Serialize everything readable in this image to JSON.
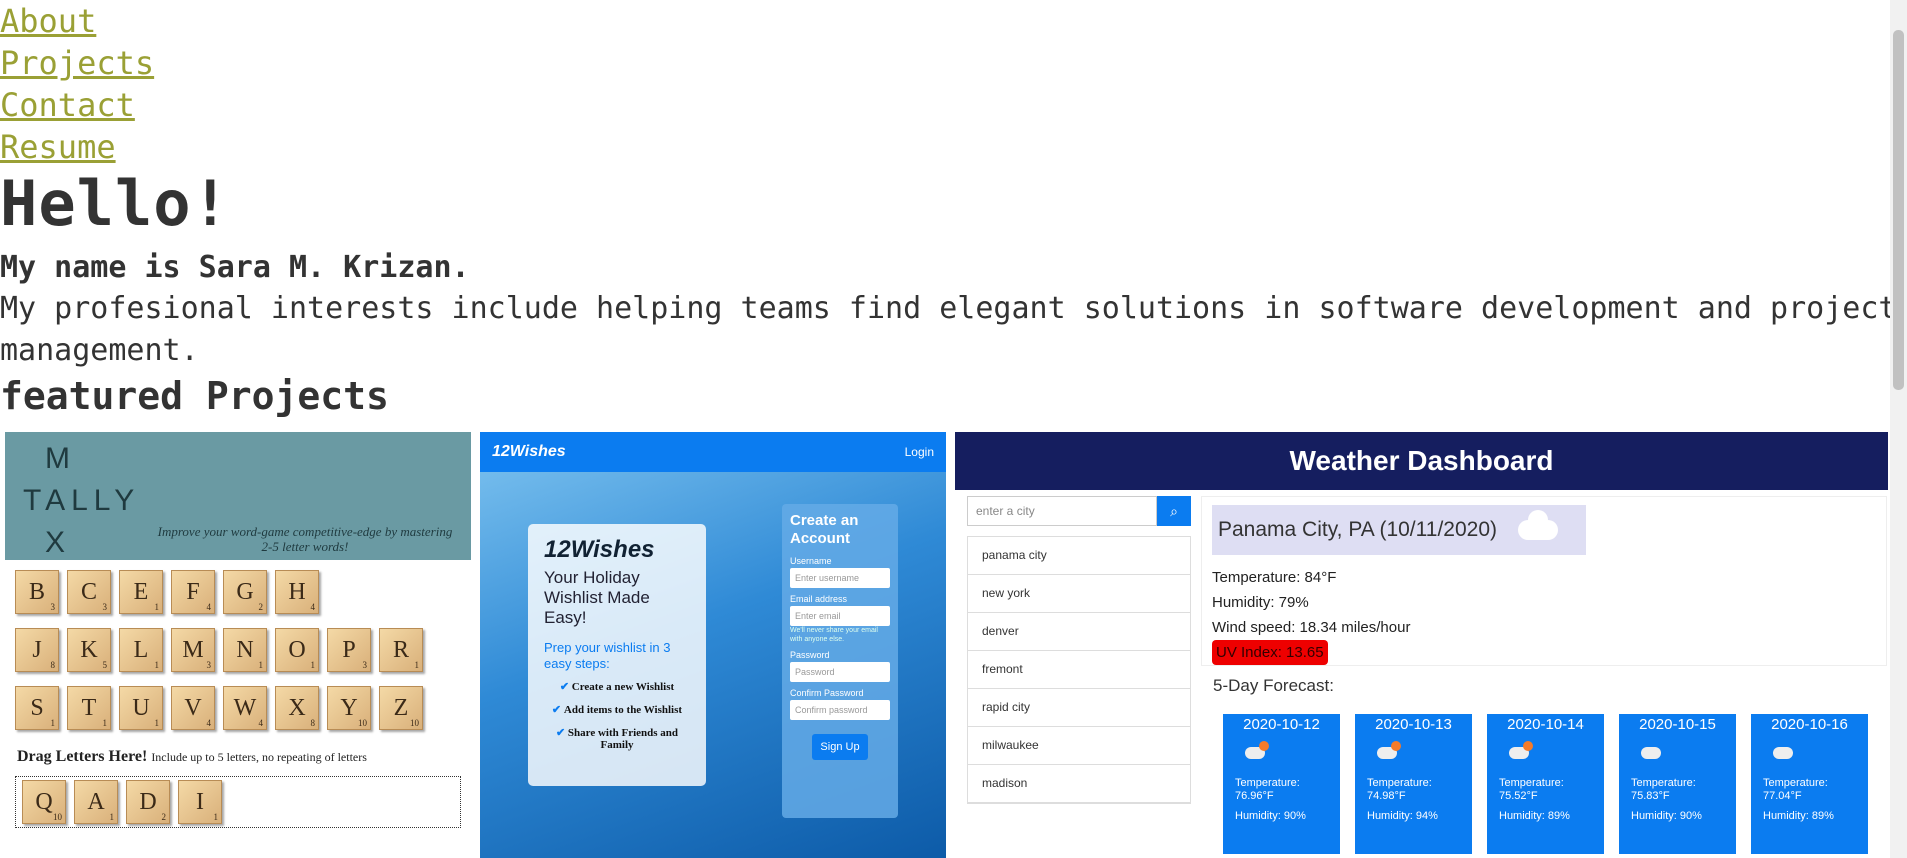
{
  "nav": {
    "about": "About",
    "projects": "Projects",
    "contact": "Contact",
    "resume": "Resume"
  },
  "hero": {
    "greeting": "Hello!",
    "name": "My name is Sara M. Krizan.",
    "interests": "My profesional interests include helping teams find elegant solutions in software development and project management."
  },
  "featured": {
    "heading": "featured Projects"
  },
  "tally": {
    "logo": [
      "M",
      "TALLY",
      "X"
    ],
    "subtitle": "Improve your word-game competitive-edge by mastering 2-5 letter words!",
    "rows": [
      [
        [
          "B",
          "3"
        ],
        [
          "C",
          "3"
        ],
        [
          "E",
          "1"
        ],
        [
          "F",
          "4"
        ],
        [
          "G",
          "2"
        ],
        [
          "H",
          "4"
        ]
      ],
      [
        [
          "J",
          "8"
        ],
        [
          "K",
          "5"
        ],
        [
          "L",
          "1"
        ],
        [
          "M",
          "3"
        ],
        [
          "N",
          "1"
        ],
        [
          "O",
          "1"
        ],
        [
          "P",
          "3"
        ],
        [
          "R",
          "1"
        ]
      ],
      [
        [
          "S",
          "1"
        ],
        [
          "T",
          "1"
        ],
        [
          "U",
          "1"
        ],
        [
          "V",
          "4"
        ],
        [
          "W",
          "4"
        ],
        [
          "X",
          "8"
        ],
        [
          "Y",
          "10"
        ],
        [
          "Z",
          "10"
        ]
      ]
    ],
    "drag_title": "Drag Letters Here!",
    "drag_hint": "Include up to 5 letters, no repeating of letters",
    "dropped": [
      [
        "Q",
        "10"
      ],
      [
        "A",
        "1"
      ],
      [
        "D",
        "2"
      ],
      [
        "I",
        "1"
      ]
    ]
  },
  "wishes": {
    "logo": "12Wishes",
    "login": "Login",
    "card_logo": "12Wishes",
    "tagline": "Your Holiday Wishlist Made Easy!",
    "prep": "Prep your wishlist in 3 easy steps:",
    "steps": [
      "Create a new Wishlist",
      "Add items to the Wishlist",
      "Share with Friends and Family"
    ],
    "form": {
      "title": "Create an Account",
      "username_label": "Username",
      "username_ph": "Enter username",
      "email_label": "Email address",
      "email_ph": "Enter email",
      "email_hint": "We'll never share your email with anyone else.",
      "password_label": "Password",
      "password_ph": "Password",
      "confirm_label": "Confirm Password",
      "confirm_ph": "Confirm password",
      "submit": "Sign Up"
    }
  },
  "weather": {
    "title": "Weather Dashboard",
    "search_placeholder": "enter a city",
    "cities": [
      "panama city",
      "new york",
      "denver",
      "fremont",
      "rapid city",
      "milwaukee",
      "madison"
    ],
    "current": {
      "title": "Panama City, PA (10/11/2020)",
      "temperature": "Temperature: 84°F",
      "humidity": "Humidity: 79%",
      "wind": "Wind speed: 18.34 miles/hour",
      "uv": "UV Index: 13.65"
    },
    "forecast_heading": "5-Day Forecast:",
    "forecast": [
      {
        "date": "2020-10-12",
        "temp": "Temperature: 76.96°F",
        "humidity": "Humidity: 90%",
        "icon": "rain-cloud-icon"
      },
      {
        "date": "2020-10-13",
        "temp": "Temperature: 74.98°F",
        "humidity": "Humidity: 94%",
        "icon": "rain-cloud-icon"
      },
      {
        "date": "2020-10-14",
        "temp": "Temperature: 75.52°F",
        "humidity": "Humidity: 89%",
        "icon": "rain-cloud-icon"
      },
      {
        "date": "2020-10-15",
        "temp": "Temperature: 75.83°F",
        "humidity": "Humidity: 90%",
        "icon": "cloud-icon"
      },
      {
        "date": "2020-10-16",
        "temp": "Temperature: 77.04°F",
        "humidity": "Humidity: 89%",
        "icon": "cloud-icon"
      }
    ]
  },
  "colors": {
    "link": "#9aa035",
    "weather_header": "#151e5f",
    "accent_blue": "#0b7cf0",
    "uv_red": "#e00000"
  }
}
